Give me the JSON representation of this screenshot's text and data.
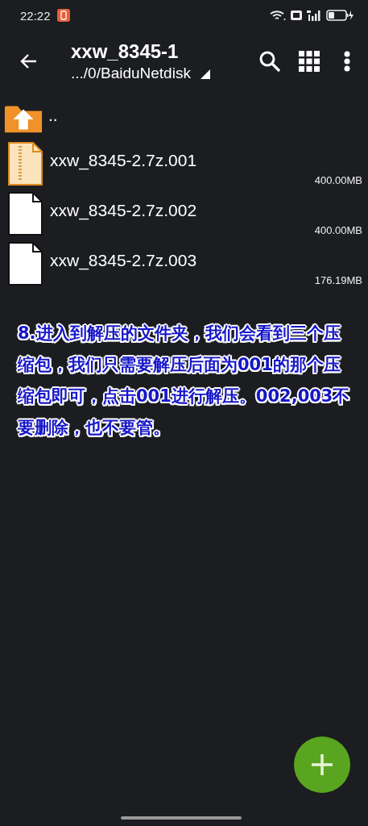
{
  "status_bar": {
    "time": "22:22"
  },
  "toolbar": {
    "title": "xxw_8345-1",
    "path": ".../0/BaiduNetdisk"
  },
  "files": [
    {
      "kind": "parent",
      "name": ".."
    },
    {
      "kind": "archive",
      "name": "xxw_8345-2.7z.001",
      "size": "400.00MB"
    },
    {
      "kind": "file",
      "name": "xxw_8345-2.7z.002",
      "size": "400.00MB"
    },
    {
      "kind": "file",
      "name": "xxw_8345-2.7z.003",
      "size": "176.19MB"
    }
  ],
  "annotation": "8.进入到解压的文件夹，我们会看到三个压缩包，我们只需要解压后面为001的那个压缩包即可，点击001进行解压。002,003不要删除，也不要管。"
}
